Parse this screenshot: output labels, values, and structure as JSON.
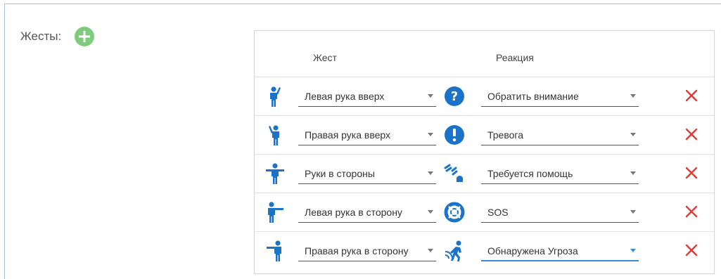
{
  "gestures_label": "Жесты:",
  "table": {
    "col_gesture": "Жест",
    "col_reaction": "Реакция"
  },
  "rows": [
    {
      "gesture": "Левая рука вверх",
      "gesture_icon": "left-hand-up-icon",
      "reaction": "Обратить внимание",
      "reaction_icon": "question-icon"
    },
    {
      "gesture": "Правая рука вверх",
      "gesture_icon": "right-hand-up-icon",
      "reaction": "Тревога",
      "reaction_icon": "exclamation-icon"
    },
    {
      "gesture": "Руки в стороны",
      "gesture_icon": "arms-out-icon",
      "reaction": "Требуется помощь",
      "reaction_icon": "call-help-icon"
    },
    {
      "gesture": "Левая рука в сторону",
      "gesture_icon": "left-arm-side-icon",
      "reaction": "SOS",
      "reaction_icon": "lifebuoy-icon"
    },
    {
      "gesture": "Правая рука в сторону",
      "gesture_icon": "right-arm-side-icon",
      "reaction": "Обнаружена Угроза",
      "reaction_icon": "threat-detected-icon"
    }
  ],
  "colors": {
    "accent": "#1a73c8",
    "add_green": "#7ecb7e",
    "delete_red": "#e53935",
    "active_underline": "#3a8bd8"
  }
}
